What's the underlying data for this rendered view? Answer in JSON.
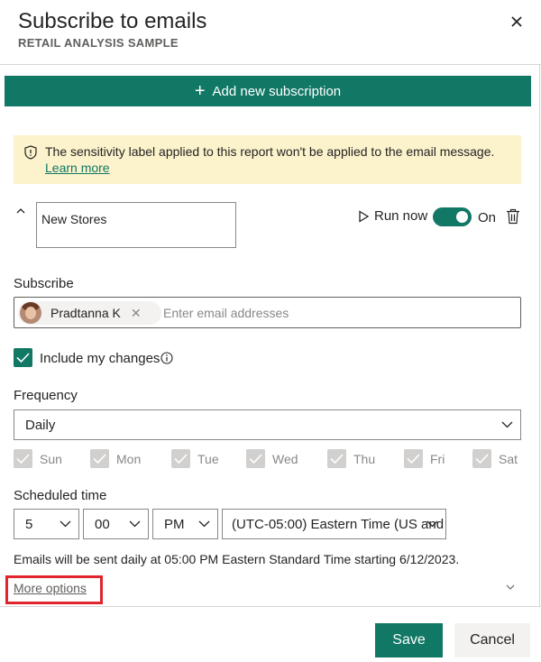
{
  "dialog": {
    "title": "Subscribe to emails",
    "subtitle": "RETAIL ANALYSIS SAMPLE"
  },
  "toolbar": {
    "add_subscription_label": "Add new subscription"
  },
  "banner": {
    "message": "The sensitivity label applied to this report won't be applied to the email message.",
    "link": "Learn more",
    "color": "#fcf2cc"
  },
  "subscription": {
    "name": "New Stores",
    "run_now_label": "Run now",
    "toggle_label": "On",
    "toggle_on": true
  },
  "subscribe": {
    "label": "Subscribe",
    "recipient": "Pradtanna K",
    "placeholder": "Enter email addresses"
  },
  "include_changes": {
    "label": "Include my changes",
    "checked": true
  },
  "frequency": {
    "label": "Frequency",
    "selected": "Daily"
  },
  "days": [
    {
      "label": "Sun",
      "checked": true
    },
    {
      "label": "Mon",
      "checked": true
    },
    {
      "label": "Tue",
      "checked": true
    },
    {
      "label": "Wed",
      "checked": true
    },
    {
      "label": "Thu",
      "checked": true
    },
    {
      "label": "Fri",
      "checked": true
    },
    {
      "label": "Sat",
      "checked": true
    }
  ],
  "schedule": {
    "label": "Scheduled time",
    "hour": "5",
    "minute": "00",
    "ampm": "PM",
    "timezone": "(UTC-05:00) Eastern Time (US and"
  },
  "summary": "Emails will be sent daily at 05:00 PM Eastern Standard Time starting 6/12/2023.",
  "more_options": "More options",
  "footer": {
    "save_label": "Save",
    "cancel_label": "Cancel"
  },
  "colors": {
    "accent": "#117865",
    "highlight": "#e0252d"
  }
}
